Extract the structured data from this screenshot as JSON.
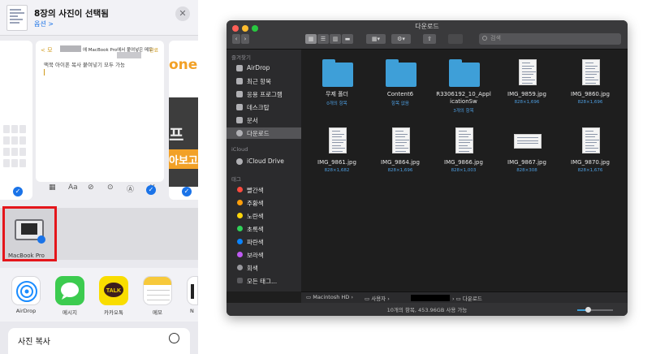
{
  "ios": {
    "header_title": "8장의 사진이 선택됨",
    "options_label": "옵션 >",
    "close_glyph": "✕",
    "note": {
      "back_label": "< 모",
      "top_text": "에 MacBook Pro에서 붙여넣은 메모",
      "done_label": "완료",
      "body_text": "맥북 아이폰 복사 붙여넣기 모두 가능"
    },
    "right_preview": {
      "top_text": "one",
      "big_text": "프",
      "banner_text": "아보고"
    },
    "toolbar_icons": [
      "table-icon",
      "text-format-icon",
      "checklist-icon",
      "camera-icon",
      "markup-icon",
      "close-icon"
    ],
    "toolbar_glyphs": [
      "▦",
      "Aa",
      "⊘",
      "⊙",
      "Ⓐ",
      "✕"
    ],
    "airdrop_target_label": "MacBook Pro",
    "apps": [
      {
        "label": "AirDrop",
        "color": "#ffffff",
        "icon": "airdrop-icon"
      },
      {
        "label": "메시지",
        "color": "#3ccb4f",
        "icon": "messages-icon"
      },
      {
        "label": "카카오톡",
        "color": "#f9dd00",
        "icon": "kakaotalk-icon",
        "glyph": "TALK"
      },
      {
        "label": "메모",
        "color": "#ffffff",
        "icon": "notes-icon"
      },
      {
        "label": "N",
        "color": "#ffffff",
        "icon": "app-partial-icon"
      }
    ],
    "copy_action_label": "사진 복사"
  },
  "finder": {
    "window_title": "다운로드",
    "search_placeholder": "검색",
    "sidebar": {
      "favorites_header": "즐겨찾기",
      "favorites": [
        {
          "label": "AirDrop",
          "icon": "airdrop-icon"
        },
        {
          "label": "최근 항목",
          "icon": "recents-icon"
        },
        {
          "label": "응용 프로그램",
          "icon": "applications-icon"
        },
        {
          "label": "데스크탑",
          "icon": "desktop-icon"
        },
        {
          "label": "문서",
          "icon": "documents-icon"
        },
        {
          "label": "다운로드",
          "icon": "downloads-icon",
          "selected": true
        }
      ],
      "icloud_header": "iCloud",
      "icloud": [
        {
          "label": "iCloud Drive",
          "icon": "icloud-icon"
        }
      ],
      "tags_header": "태그",
      "tags": [
        {
          "label": "빨간색",
          "color": "#ff4b3e"
        },
        {
          "label": "주황색",
          "color": "#ff9f0a"
        },
        {
          "label": "노란색",
          "color": "#ffd60a"
        },
        {
          "label": "초록색",
          "color": "#30d158"
        },
        {
          "label": "파란색",
          "color": "#0a84ff"
        },
        {
          "label": "보라색",
          "color": "#bf5af2"
        },
        {
          "label": "회색",
          "color": "#98989d"
        },
        {
          "label": "모든 태그...",
          "color": "#5a5a5e"
        }
      ]
    },
    "files": [
      {
        "name": "무제 폴더",
        "sub": "0개의 항목",
        "kind": "folder"
      },
      {
        "name": "Content6",
        "sub": "항목 없음",
        "kind": "folder"
      },
      {
        "name": "R3306192_10_ApplicationSw",
        "sub": "3개의 항목",
        "kind": "folder"
      },
      {
        "name": "IMG_9859.jpg",
        "sub": "828×1,696",
        "kind": "doc"
      },
      {
        "name": "IMG_9860.jpg",
        "sub": "828×1,696",
        "kind": "doc"
      },
      {
        "name": "IMG_9861.jpg",
        "sub": "828×1,682",
        "kind": "doc"
      },
      {
        "name": "IMG_9864.jpg",
        "sub": "828×1,696",
        "kind": "doc"
      },
      {
        "name": "IMG_9866.jpg",
        "sub": "828×1,003",
        "kind": "doc"
      },
      {
        "name": "IMG_9867.jpg",
        "sub": "828×308",
        "kind": "wide"
      },
      {
        "name": "IMG_9870.jpg",
        "sub": "828×1,676",
        "kind": "doc"
      }
    ],
    "path": [
      "Macintosh HD",
      "사용자",
      "",
      "다운로드"
    ],
    "status_text": "10개의 항목, 453.96GB 사용 가능",
    "icon_size_slider": 0.3
  }
}
